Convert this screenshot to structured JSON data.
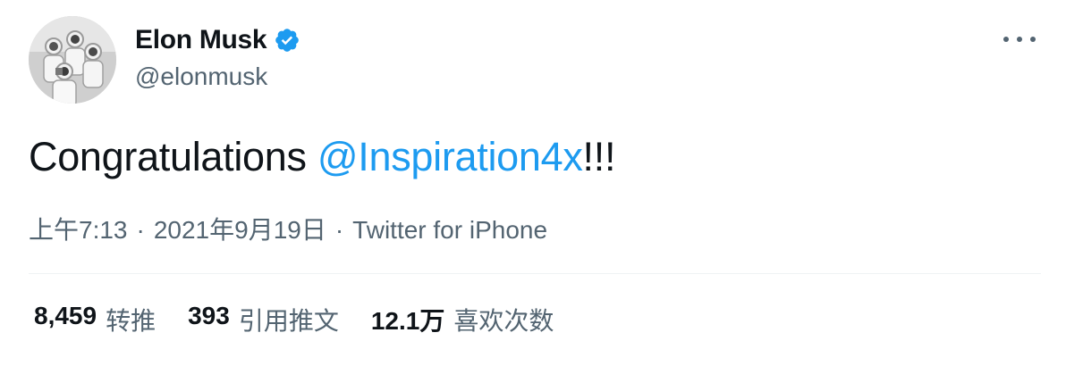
{
  "user": {
    "display_name": "Elon Musk",
    "handle": "@elonmusk",
    "verified": true
  },
  "tweet": {
    "text_before": "Congratulations ",
    "mention": "@Inspiration4x",
    "text_after": "!!!",
    "time": "上午7:13",
    "date": "2021年9月19日",
    "separator": "·",
    "source": "Twitter for iPhone"
  },
  "stats": [
    {
      "value": "8,459",
      "label": "转推"
    },
    {
      "value": "393",
      "label": "引用推文"
    },
    {
      "value": "12.1万",
      "label": "喜欢次数"
    }
  ],
  "colors": {
    "accent": "#1d9bf0",
    "text": "#0f1419",
    "secondary": "#536471"
  },
  "icons": {
    "verified": "verified-badge-icon",
    "more": "more-options-icon"
  }
}
